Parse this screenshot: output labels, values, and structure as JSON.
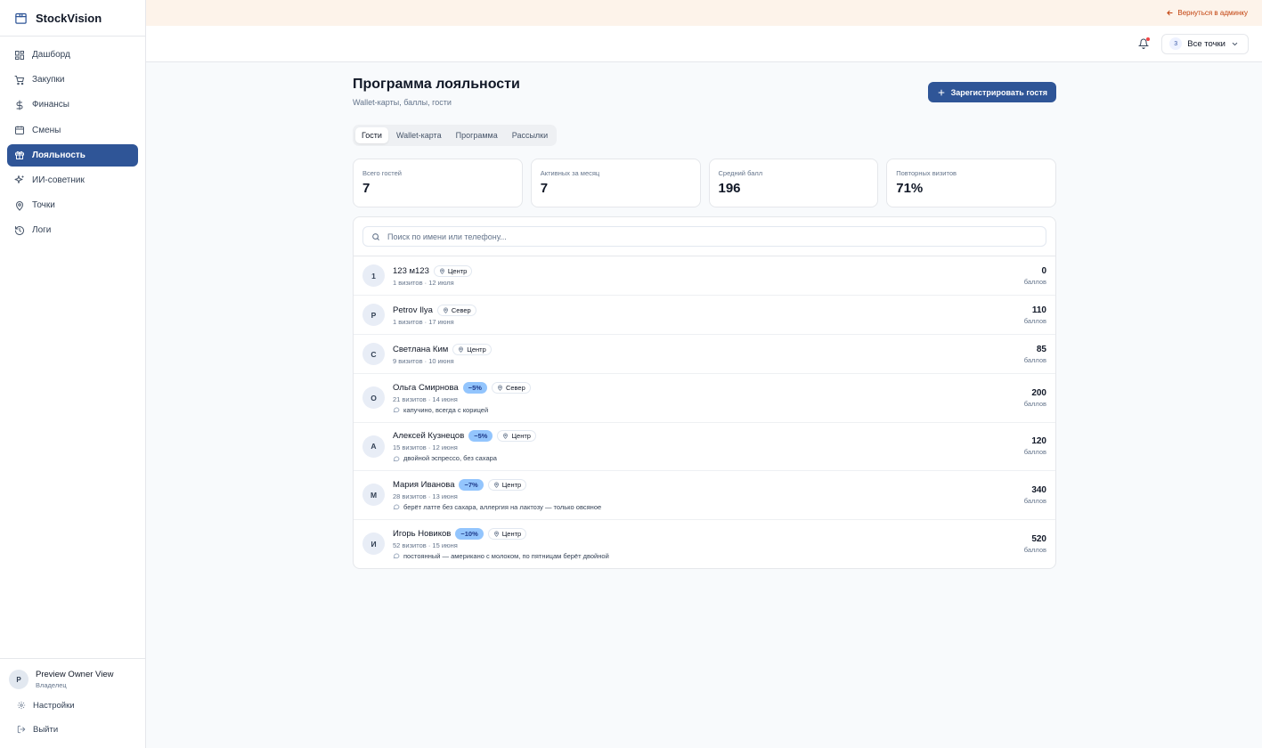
{
  "app": {
    "name": "StockVision",
    "logo_icon": "package-icon"
  },
  "sidebar": {
    "items": [
      {
        "label": "Дашборд",
        "icon": "dashboard-icon",
        "active": false
      },
      {
        "label": "Закупки",
        "icon": "cart-icon",
        "active": false
      },
      {
        "label": "Финансы",
        "icon": "dollar-icon",
        "active": false
      },
      {
        "label": "Смены",
        "icon": "calendar-icon",
        "active": false
      },
      {
        "label": "Лояльность",
        "icon": "gift-icon",
        "active": true
      },
      {
        "label": "ИИ-советник",
        "icon": "sparkles-icon",
        "active": false
      },
      {
        "label": "Точки",
        "icon": "map-pin-icon",
        "active": false
      },
      {
        "label": "Логи",
        "icon": "history-icon",
        "active": false
      }
    ],
    "user": {
      "initial": "P",
      "name": "Preview Owner View",
      "role": "Владелец"
    },
    "settings_label": "Настройки",
    "logout_label": "Выйти"
  },
  "banner": {
    "back_label": "Вернуться в админку"
  },
  "topbar": {
    "points_count": "3",
    "points_label": "Все точки"
  },
  "page": {
    "title": "Программа лояльности",
    "subtitle": "Wallet-карты, баллы, гости",
    "primary_button": "Зарегистрировать гостя"
  },
  "tabs": [
    {
      "label": "Гости",
      "active": true
    },
    {
      "label": "Wallet-карта",
      "active": false
    },
    {
      "label": "Программа",
      "active": false
    },
    {
      "label": "Рассылки",
      "active": false
    }
  ],
  "stats": [
    {
      "label": "Всего гостей",
      "value": "7"
    },
    {
      "label": "Активных за месяц",
      "value": "7"
    },
    {
      "label": "Средний балл",
      "value": "196"
    },
    {
      "label": "Повторных визитов",
      "value": "71%"
    }
  ],
  "search": {
    "placeholder": "Поиск по имени или телефону..."
  },
  "points_unit": "баллов",
  "guests": [
    {
      "initial": "1",
      "name": "123 м123",
      "discount": "",
      "location": "Центр",
      "meta": "1 визитов · 12 июля",
      "note": "",
      "points": "0"
    },
    {
      "initial": "P",
      "name": "Petrov Ilya",
      "discount": "",
      "location": "Север",
      "meta": "1 визитов · 17 июня",
      "note": "",
      "points": "110"
    },
    {
      "initial": "С",
      "name": "Светлана Ким",
      "discount": "",
      "location": "Центр",
      "meta": "9 визитов · 10 июня",
      "note": "",
      "points": "85"
    },
    {
      "initial": "О",
      "name": "Ольга Смирнова",
      "discount": "−5%",
      "location": "Север",
      "meta": "21 визитов · 14 июня",
      "note": "капучино, всегда с корицей",
      "points": "200"
    },
    {
      "initial": "А",
      "name": "Алексей Кузнецов",
      "discount": "−5%",
      "location": "Центр",
      "meta": "15 визитов · 12 июня",
      "note": "двойной эспрессо, без сахара",
      "points": "120"
    },
    {
      "initial": "М",
      "name": "Мария Иванова",
      "discount": "−7%",
      "location": "Центр",
      "meta": "28 визитов · 13 июня",
      "note": "берёт латте без сахара, аллергия на лактозу — только овсяное",
      "points": "340"
    },
    {
      "initial": "И",
      "name": "Игорь Новиков",
      "discount": "−10%",
      "location": "Центр",
      "meta": "52 визитов · 15 июня",
      "note": "постоянный — американо с молоком, по пятницам берёт двойной",
      "points": "520"
    }
  ],
  "colors": {
    "accent": "#2f5597",
    "banner_bg": "#fdf3ea",
    "banner_link": "#c2410c",
    "discount_badge": "#93c5fd"
  }
}
